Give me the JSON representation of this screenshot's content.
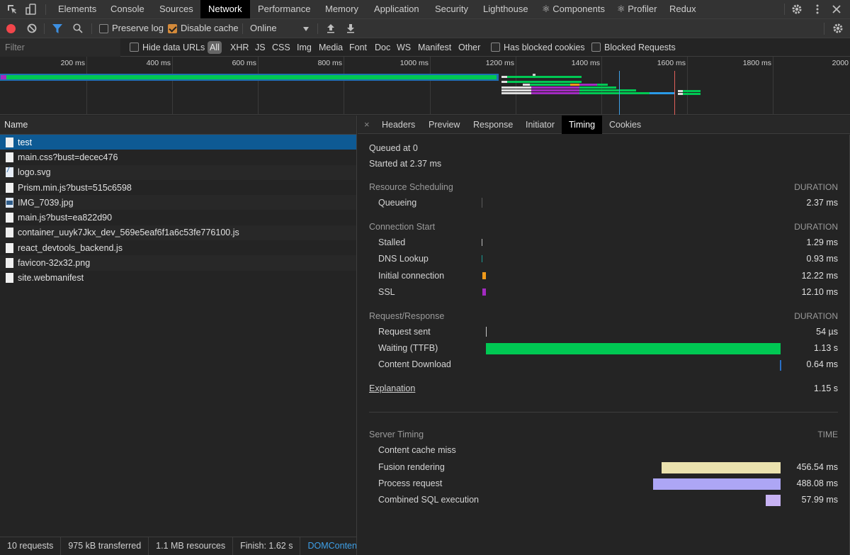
{
  "tabbar": {
    "tabs": [
      "Elements",
      "Console",
      "Sources",
      "Network",
      "Performance",
      "Memory",
      "Application",
      "Security",
      "Lighthouse",
      "⚛ Components",
      "⚛ Profiler",
      "Redux"
    ],
    "active": "Network"
  },
  "toolbar": {
    "preserve_log": {
      "label": "Preserve log",
      "checked": false
    },
    "disable_cache": {
      "label": "Disable cache",
      "checked": true
    },
    "throttling": "Online"
  },
  "filterbar": {
    "placeholder": "Filter",
    "hide_data_urls": "Hide data URLs",
    "types": [
      "All",
      "XHR",
      "JS",
      "CSS",
      "Img",
      "Media",
      "Font",
      "Doc",
      "WS",
      "Manifest",
      "Other"
    ],
    "has_blocked_cookies": "Has blocked cookies",
    "blocked_requests": "Blocked Requests"
  },
  "overview": {
    "ticks": [
      "200 ms",
      "400 ms",
      "600 ms",
      "800 ms",
      "1000 ms",
      "1200 ms",
      "1400 ms",
      "1600 ms",
      "1800 ms",
      "2000"
    ],
    "dom_content_loaded_ms": 1465,
    "load_ms": 1595
  },
  "requests": {
    "header": "Name",
    "items": [
      {
        "name": "test",
        "type": "doc",
        "selected": true
      },
      {
        "name": "main.css?bust=decec476",
        "type": "doc"
      },
      {
        "name": "logo.svg",
        "type": "svg"
      },
      {
        "name": "Prism.min.js?bust=515c6598",
        "type": "doc"
      },
      {
        "name": "IMG_7039.jpg",
        "type": "img"
      },
      {
        "name": "main.js?bust=ea822d90",
        "type": "doc"
      },
      {
        "name": "container_uuyk7Jkx_dev_569e5eaf6f1a6c53fe776100.js",
        "type": "doc"
      },
      {
        "name": "react_devtools_backend.js",
        "type": "doc"
      },
      {
        "name": "favicon-32x32.png",
        "type": "doc"
      },
      {
        "name": "site.webmanifest",
        "type": "doc"
      }
    ]
  },
  "status": {
    "requests": "10 requests",
    "transferred": "975 kB transferred",
    "resources": "1.1 MB resources",
    "finish": "Finish: 1.62 s",
    "dom": "DOMContentL"
  },
  "details": {
    "tabs": [
      "Headers",
      "Preview",
      "Response",
      "Initiator",
      "Timing",
      "Cookies"
    ],
    "active": "Timing",
    "queued": "Queued at 0",
    "started": "Started at 2.37 ms",
    "duration_label": "DURATION",
    "time_label": "TIME",
    "sections": {
      "scheduling": {
        "title": "Resource Scheduling",
        "rows": [
          {
            "label": "Queueing",
            "value": "2.37 ms"
          }
        ]
      },
      "connection": {
        "title": "Connection Start",
        "rows": [
          {
            "label": "Stalled",
            "value": "1.29 ms"
          },
          {
            "label": "DNS Lookup",
            "value": "0.93 ms"
          },
          {
            "label": "Initial connection",
            "value": "12.22 ms"
          },
          {
            "label": "SSL",
            "value": "12.10 ms"
          }
        ]
      },
      "reqres": {
        "title": "Request/Response",
        "rows": [
          {
            "label": "Request sent",
            "value": "54 µs"
          },
          {
            "label": "Waiting (TTFB)",
            "value": "1.13 s"
          },
          {
            "label": "Content Download",
            "value": "0.64 ms"
          }
        ]
      }
    },
    "explanation": {
      "label": "Explanation",
      "total": "1.15 s"
    },
    "server_timing": {
      "title": "Server Timing",
      "rows": [
        {
          "label": "Content cache miss",
          "value": ""
        },
        {
          "label": "Fusion rendering",
          "value": "456.54 ms"
        },
        {
          "label": "Process request",
          "value": "488.08 ms"
        },
        {
          "label": "Combined SQL execution",
          "value": "57.99 ms"
        }
      ]
    },
    "colors": {
      "queueing": "#5a5a5a",
      "stalled": "#bdbdbd",
      "dns": "#1a9a94",
      "connect": "#f09a1a",
      "ssl": "#a32bc1",
      "sent": "#c8c8c8",
      "ttfb": "#00c853",
      "download": "#2a6fc4",
      "fusion": "#ebe2ae",
      "process": "#ada6f5",
      "sql": "#c7b2f3"
    }
  }
}
